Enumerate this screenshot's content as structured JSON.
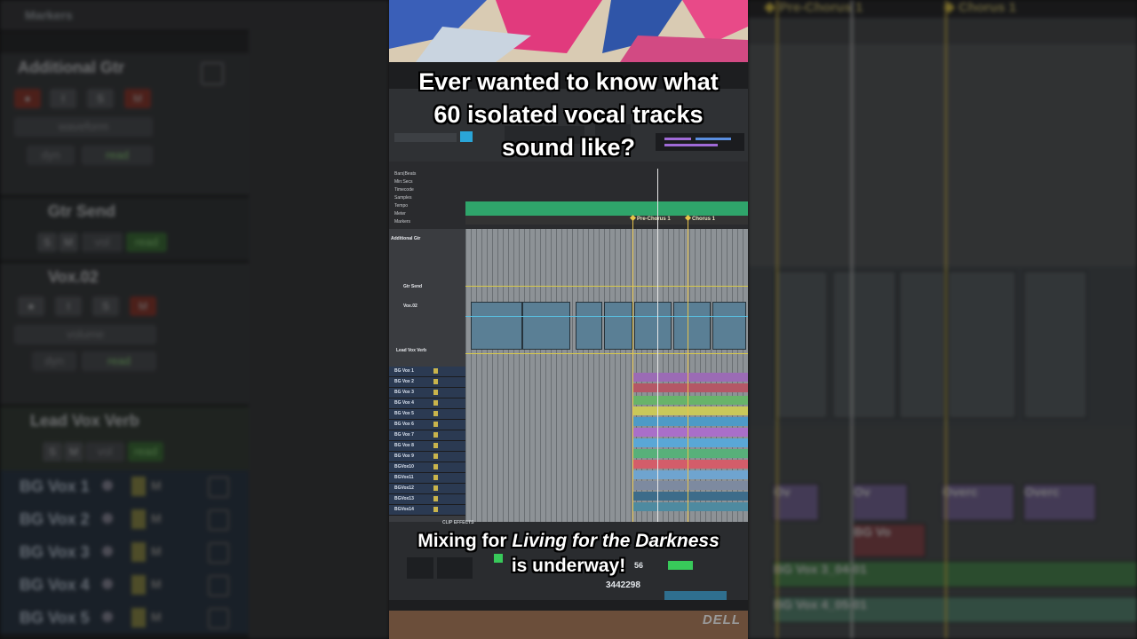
{
  "caption": {
    "top_lines": [
      "Ever wanted to know what",
      "60 isolated vocal tracks",
      "sound like?"
    ],
    "bottom_prefix": "Mixing for ",
    "bottom_title": "Living for the Darkness",
    "bottom_suffix": "is underway!"
  },
  "left_panel": {
    "markers_label": "Markers",
    "strips": [
      {
        "name": "Additional Gtr",
        "view": "waveform",
        "mode": "dyn",
        "auto": "read"
      },
      {
        "name": "Gtr Send",
        "solo": "S",
        "mute": "M",
        "param": "vol",
        "auto": "read"
      },
      {
        "name": "Vox.02",
        "view": "volume",
        "mode": "dyn",
        "auto": "read"
      },
      {
        "name": "Lead Vox Verb",
        "solo": "S",
        "mute": "M",
        "param": "vol",
        "auto": "read"
      }
    ],
    "bg_rows": [
      "BG Vox 1",
      "BG Vox 2",
      "BG Vox 3",
      "BG Vox 4",
      "BG Vox 5"
    ],
    "m_label": "M"
  },
  "right_panel": {
    "markers": [
      "Pre-Chorus 1",
      "Chorus 1"
    ],
    "clip_labels": [
      "Ov",
      "Ov",
      "Overc",
      "Overc",
      "BG Vo",
      "BG Vox 3_04-01",
      "BG Vox 4_05-01"
    ]
  },
  "protools": {
    "ruler_labels": [
      "Bars|Beats",
      "Min:Secs",
      "Timecode",
      "Samples",
      "Tempo",
      "Meter",
      "Markers"
    ],
    "markers": [
      "Pre-Chorus 1",
      "Chorus 1"
    ],
    "tracks": [
      "Additional Gtr",
      "Gtr Send",
      "Vox.02",
      "Lead Vox Verb"
    ],
    "bg_tracks": [
      "BG Vox 1",
      "BG Vox 2",
      "BG Vox 3",
      "BG Vox 4",
      "BG Vox 5",
      "BG Vox 6",
      "BG Vox 7",
      "BG Vox 8",
      "BG Vox 9",
      "BGVox10",
      "BGVox11",
      "BGVox12",
      "BGVox13",
      "BGVox14"
    ],
    "clip_effects": "CLIP EFFECTS",
    "counter": "3442298",
    "counter_small": "56"
  },
  "colors": {
    "tempo_green": "#2fa56b",
    "marker_yellow": "#e5c64a",
    "clip_blue": "#5a7f95"
  },
  "brand": "DELL"
}
